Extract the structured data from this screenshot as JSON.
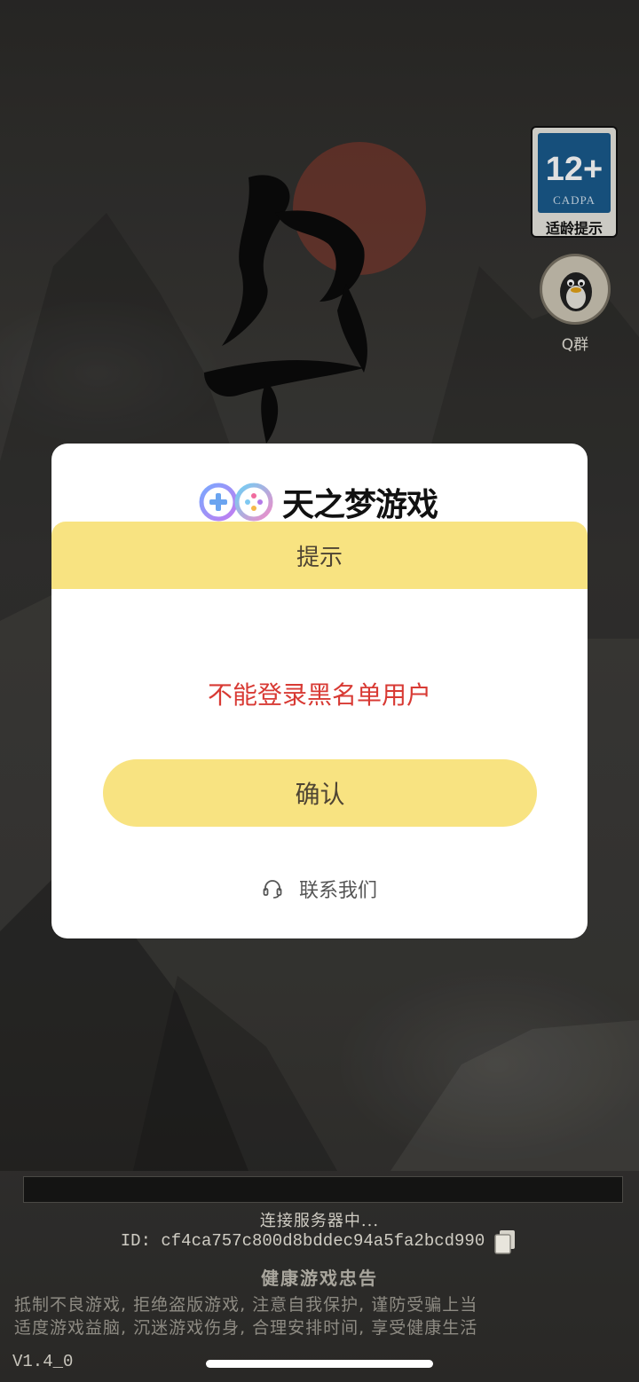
{
  "app": {
    "age_rating": {
      "number": "12+",
      "org": "CADPA",
      "caption": "适龄提示"
    },
    "qq_group_label": "Q群"
  },
  "dialog": {
    "brand_name": "天之梦游戏",
    "header_title": "提示",
    "message": "不能登录黑名单用户",
    "confirm_label": "确认",
    "contact_label": "联系我们"
  },
  "footer": {
    "status": "连接服务器中...",
    "id_text": "ID: cf4ca757c800d8bddec94a5fa2bcd990",
    "notice_title": "健康游戏忠告",
    "notice_lines": [
      "抵制不良游戏, 拒绝盗版游戏, 注意自我保护, 谨防受骗上当",
      "适度游戏益脑, 沉迷游戏伤身, 合理安排时间, 享受健康生活"
    ],
    "version": "V1.4_0"
  },
  "colors": {
    "accent_yellow": "#f8e381",
    "error_red": "#d83a34",
    "rating_blue": "#1a5a8c"
  },
  "icons": [
    "gamepad-logo-icon",
    "headset-icon",
    "copy-icon",
    "qq-penguin-icon"
  ]
}
